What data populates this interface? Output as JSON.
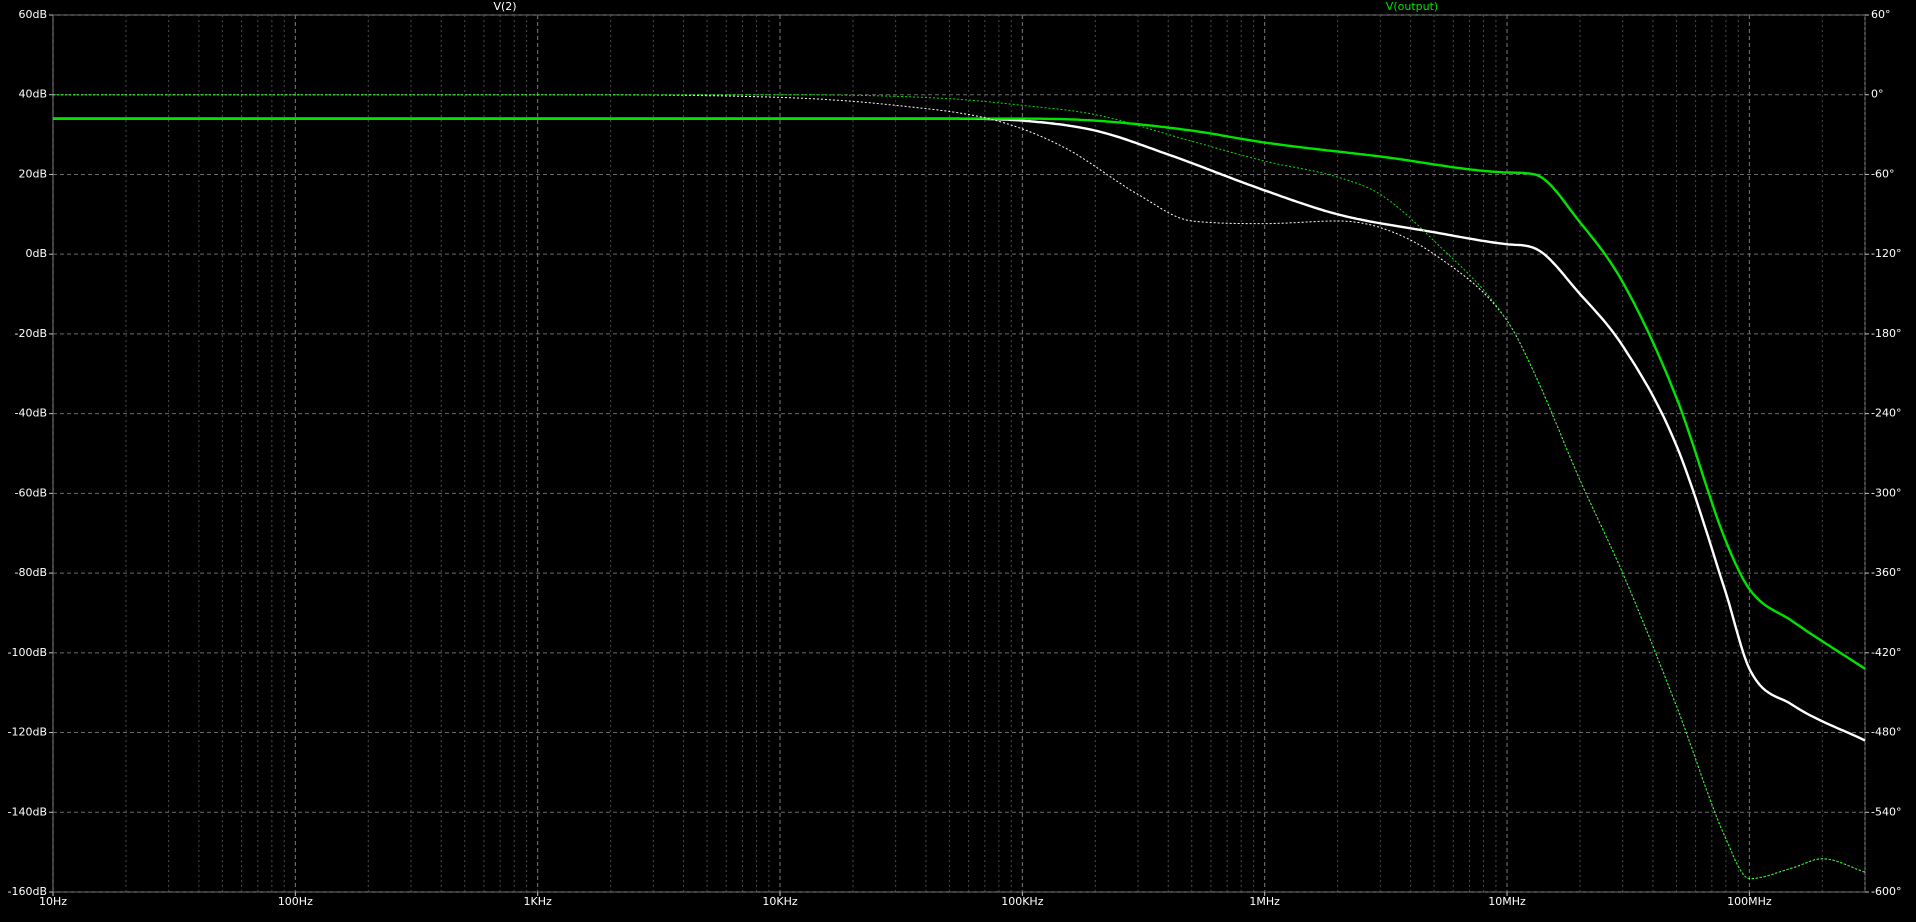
{
  "chart_data": {
    "type": "line",
    "title": "",
    "traces": [
      {
        "name": "V(2)",
        "color": "#ffffff"
      },
      {
        "name": "V(output)",
        "color": "#00e400"
      }
    ],
    "x_axis": {
      "scale": "log",
      "range_hz": [
        10,
        300000000
      ],
      "ticks": [
        {
          "value": 10,
          "label": "10Hz"
        },
        {
          "value": 100,
          "label": "100Hz"
        },
        {
          "value": 1000,
          "label": "1KHz"
        },
        {
          "value": 10000,
          "label": "10KHz"
        },
        {
          "value": 100000,
          "label": "100KHz"
        },
        {
          "value": 1000000,
          "label": "1MHz"
        },
        {
          "value": 10000000,
          "label": "10MHz"
        },
        {
          "value": 100000000,
          "label": "100MHz"
        }
      ]
    },
    "y_left_axis": {
      "unit": "dB",
      "range": [
        -160,
        60
      ],
      "ticks": [
        {
          "value": 60,
          "label": "60dB"
        },
        {
          "value": 40,
          "label": "40dB"
        },
        {
          "value": 20,
          "label": "20dB"
        },
        {
          "value": 0,
          "label": "0dB"
        },
        {
          "value": -20,
          "label": "-20dB"
        },
        {
          "value": -40,
          "label": "-40dB"
        },
        {
          "value": -60,
          "label": "-60dB"
        },
        {
          "value": -80,
          "label": "-80dB"
        },
        {
          "value": -100,
          "label": "-100dB"
        },
        {
          "value": -120,
          "label": "-120dB"
        },
        {
          "value": -140,
          "label": "-140dB"
        },
        {
          "value": -160,
          "label": "-160dB"
        }
      ]
    },
    "y_right_axis": {
      "unit": "deg",
      "range": [
        -600,
        60
      ],
      "ticks": [
        {
          "value": 60,
          "label": "60°"
        },
        {
          "value": 0,
          "label": "0°"
        },
        {
          "value": -60,
          "label": "-60°"
        },
        {
          "value": -120,
          "label": "-120°"
        },
        {
          "value": -180,
          "label": "-180°"
        },
        {
          "value": -240,
          "label": "-240°"
        },
        {
          "value": -300,
          "label": "-300°"
        },
        {
          "value": -360,
          "label": "-360°"
        },
        {
          "value": -420,
          "label": "-420°"
        },
        {
          "value": -480,
          "label": "-480°"
        },
        {
          "value": -540,
          "label": "-540°"
        },
        {
          "value": -600,
          "label": "-600°"
        }
      ]
    },
    "grid": true,
    "series": [
      {
        "name": "V(2) magnitude",
        "trace": "V(2)",
        "kind": "magnitude",
        "color": "#ffffff",
        "style": "solid",
        "points": [
          [
            10,
            34
          ],
          [
            1000,
            34
          ],
          [
            10000,
            34
          ],
          [
            50000,
            34
          ],
          [
            100000,
            33.5
          ],
          [
            200000,
            31
          ],
          [
            400000,
            25
          ],
          [
            1000000,
            16
          ],
          [
            2000000,
            10
          ],
          [
            5000000,
            5.5
          ],
          [
            10000000,
            2.5
          ],
          [
            13000000,
            1.5
          ],
          [
            20000000,
            -10
          ],
          [
            30000000,
            -23
          ],
          [
            50000000,
            -48
          ],
          [
            80000000,
            -85
          ],
          [
            100000000,
            -104
          ],
          [
            150000000,
            -113
          ],
          [
            300000000,
            -122
          ]
        ]
      },
      {
        "name": "V(output) magnitude",
        "trace": "V(output)",
        "kind": "magnitude",
        "color": "#00e400",
        "style": "solid",
        "points": [
          [
            10,
            34
          ],
          [
            1000,
            34
          ],
          [
            10000,
            34
          ],
          [
            100000,
            34
          ],
          [
            200000,
            33.5
          ],
          [
            500000,
            31
          ],
          [
            1000000,
            28
          ],
          [
            3000000,
            24.5
          ],
          [
            10000000,
            20.5
          ],
          [
            13000000,
            20
          ],
          [
            20000000,
            8
          ],
          [
            30000000,
            -7
          ],
          [
            50000000,
            -36
          ],
          [
            80000000,
            -72
          ],
          [
            100000000,
            -84
          ],
          [
            150000000,
            -92
          ],
          [
            300000000,
            -104
          ]
        ]
      },
      {
        "name": "V(2) phase",
        "trace": "V(2)",
        "kind": "phase",
        "color": "#ffffff",
        "style": "dotted",
        "points": [
          [
            10,
            0
          ],
          [
            1000,
            0
          ],
          [
            10000,
            -2
          ],
          [
            30000,
            -8
          ],
          [
            80000,
            -20
          ],
          [
            150000,
            -40
          ],
          [
            300000,
            -75
          ],
          [
            500000,
            -95
          ],
          [
            1000000,
            -97
          ],
          [
            2000000,
            -95
          ],
          [
            3000000,
            -100
          ],
          [
            5000000,
            -120
          ],
          [
            10000000,
            -170
          ],
          [
            13000000,
            -210
          ],
          [
            20000000,
            -290
          ],
          [
            30000000,
            -360
          ],
          [
            50000000,
            -460
          ],
          [
            80000000,
            -560
          ],
          [
            100000000,
            -590
          ],
          [
            150000000,
            -582
          ],
          [
            200000000,
            -575
          ],
          [
            300000000,
            -585
          ]
        ]
      },
      {
        "name": "V(output) phase",
        "trace": "V(output)",
        "kind": "phase",
        "color": "#00e400",
        "style": "dotted",
        "points": [
          [
            10,
            0
          ],
          [
            10000,
            0
          ],
          [
            50000,
            -3
          ],
          [
            100000,
            -8
          ],
          [
            200000,
            -15
          ],
          [
            500000,
            -35
          ],
          [
            1000000,
            -50
          ],
          [
            2000000,
            -62
          ],
          [
            3000000,
            -75
          ],
          [
            5000000,
            -110
          ],
          [
            10000000,
            -170
          ],
          [
            13000000,
            -210
          ],
          [
            20000000,
            -290
          ],
          [
            30000000,
            -360
          ],
          [
            50000000,
            -460
          ],
          [
            80000000,
            -560
          ],
          [
            100000000,
            -590
          ],
          [
            150000000,
            -582
          ],
          [
            200000000,
            -575
          ],
          [
            300000000,
            -585
          ]
        ]
      }
    ]
  }
}
